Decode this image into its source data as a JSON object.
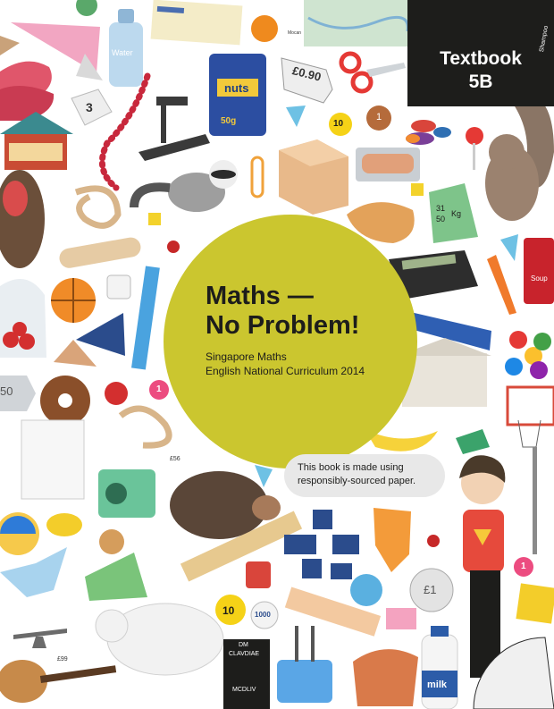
{
  "badge": {
    "line1": "Textbook",
    "line2": "5B"
  },
  "title": {
    "line1": "Maths —",
    "line2": "No Problem!"
  },
  "subtitle": {
    "line1": "Singapore Maths",
    "line2": "English National Curriculum 2014"
  },
  "speech_bubble": {
    "line1": "This book is made using",
    "line2": "responsibly-sourced paper."
  },
  "item_labels": {
    "price_tag": "£0.90",
    "nuts_word": "nuts",
    "nuts_weight": "50g",
    "water_word": "Water",
    "die_number": "3",
    "coin_ten_top": "10",
    "penny_value": "1",
    "fraction_num": "31",
    "fraction_den": "50",
    "fraction_unit": "Kg",
    "soup_word": "Soup",
    "coin_fifty": "50",
    "badge_one_left": "1",
    "radio_tag": "£56",
    "coin_ten_bottom": "10",
    "coin_thousand": "1000",
    "book_title_line1": "DM",
    "book_title_line2": "CLAVDIAE",
    "book_spine": "MCDLIV",
    "pound_coin": "£1",
    "badge_one_right": "1",
    "milk_word": "milk",
    "guitar_tag": "£99",
    "shampoo_word": "Shampoo",
    "map_label": "Mocan"
  },
  "colors": {
    "circle": "#cbc62f",
    "badge_bg": "#1d1d1b",
    "text_dark": "#1d1d1b",
    "bubble_bg": "#e8e8e8"
  }
}
